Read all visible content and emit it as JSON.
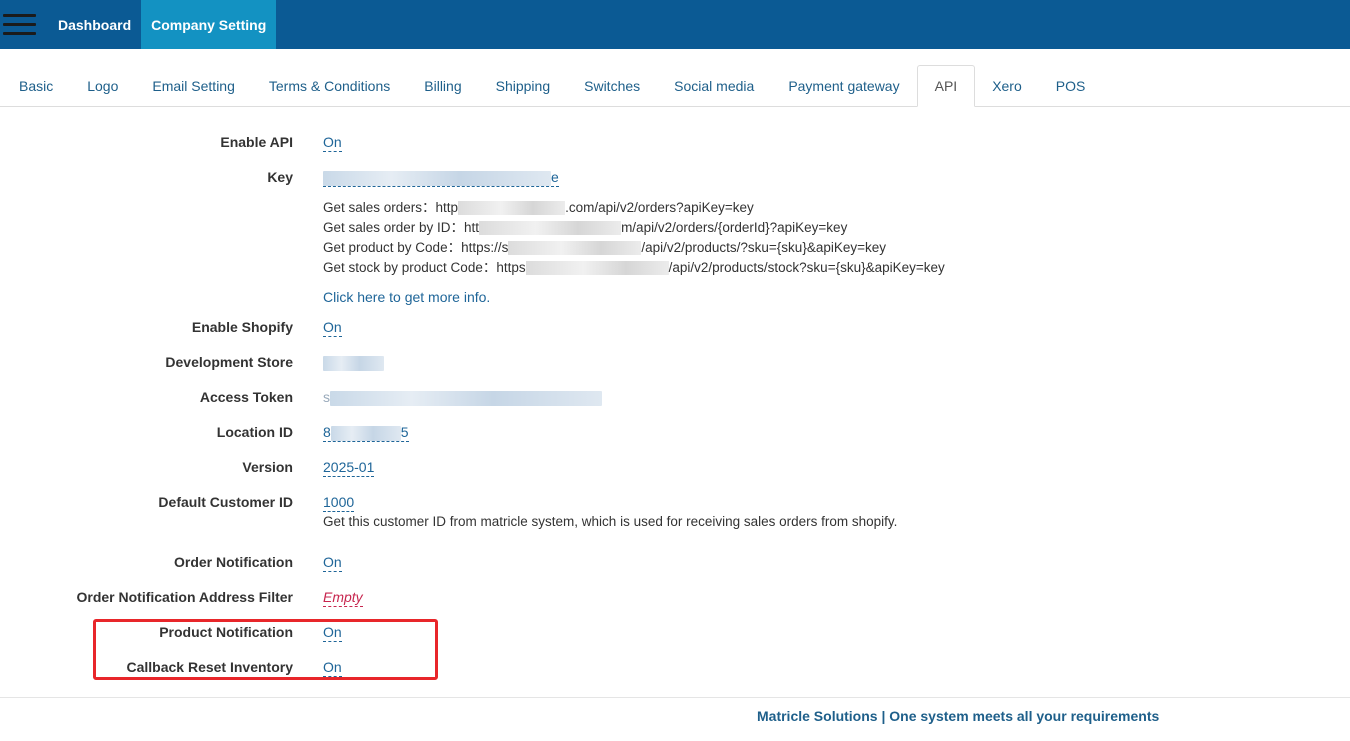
{
  "navbar": {
    "dashboard_label": "Dashboard",
    "company_setting_label": "Company Setting"
  },
  "tabs": [
    {
      "label": "Basic"
    },
    {
      "label": "Logo"
    },
    {
      "label": "Email Setting"
    },
    {
      "label": "Terms & Conditions"
    },
    {
      "label": "Billing"
    },
    {
      "label": "Shipping"
    },
    {
      "label": "Switches"
    },
    {
      "label": "Social media"
    },
    {
      "label": "Payment gateway"
    },
    {
      "label": "API"
    },
    {
      "label": "Xero"
    },
    {
      "label": "POS"
    }
  ],
  "active_tab": "API",
  "form": {
    "enable_api": {
      "label": "Enable API",
      "value": "On"
    },
    "key": {
      "label": "Key",
      "value_tail": "e"
    },
    "endpoints": [
      {
        "prefix": "Get sales orders：http",
        "suffix": ".com/api/v2/orders?apiKey=key"
      },
      {
        "prefix": "Get sales order by ID：htt",
        "suffix": "m/api/v2/orders/{orderId}?apiKey=key"
      },
      {
        "prefix": "Get product by Code：https://s",
        "suffix": "/api/v2/products/?sku={sku}&apiKey=key"
      },
      {
        "prefix": "Get stock by product Code：https",
        "suffix": "/api/v2/products/stock?sku={sku}&apiKey=key"
      }
    ],
    "more_info_link": "Click here to get more info.",
    "enable_shopify": {
      "label": "Enable Shopify",
      "value": "On"
    },
    "development_store": {
      "label": "Development Store"
    },
    "access_token": {
      "label": "Access Token",
      "value_head": "s",
      "value_mid": "502173..."
    },
    "location_id": {
      "label": "Location ID",
      "value_head": "8",
      "value_tail": "5"
    },
    "version": {
      "label": "Version",
      "value": "2025-01"
    },
    "default_customer_id": {
      "label": "Default Customer ID",
      "value": "1000",
      "help": "Get this customer ID from matricle system, which is used for receiving sales orders from shopify."
    },
    "order_notification": {
      "label": "Order Notification",
      "value": "On"
    },
    "order_notification_address_filter": {
      "label": "Order Notification Address Filter",
      "value": "Empty"
    },
    "product_notification": {
      "label": "Product Notification",
      "value": "On"
    },
    "callback_reset_inventory": {
      "label": "Callback Reset Inventory",
      "value": "On"
    }
  },
  "footer": {
    "text": "Matricle Solutions | One system meets all your requirements"
  },
  "colors": {
    "navbar": "#0b5a94",
    "active_nav": "#1392c2",
    "link": "#1e6598",
    "highlight": "#e8262a",
    "empty": "#c7254e"
  }
}
